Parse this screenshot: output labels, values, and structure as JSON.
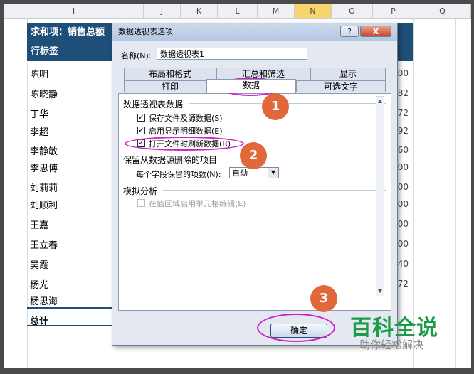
{
  "spreadsheet": {
    "columns": [
      "I",
      "J",
      "K",
      "L",
      "M",
      "N",
      "O",
      "P",
      "Q"
    ],
    "selected_column": "N",
    "pivot_header": "求和项：销售总额",
    "row_label_header": "行标签",
    "rows": [
      {
        "name": "陈明",
        "value": "600"
      },
      {
        "name": "陈晓静",
        "value": "82"
      },
      {
        "name": "丁华",
        "value": "72"
      },
      {
        "name": "李超",
        "value": "592"
      },
      {
        "name": "李静敏",
        "value": "960"
      },
      {
        "name": "李思博",
        "value": "800"
      },
      {
        "name": "刘莉莉",
        "value": "600"
      },
      {
        "name": "刘顺利",
        "value": "000"
      },
      {
        "name": "王嘉",
        "value": "200"
      },
      {
        "name": "王立春",
        "value": "700"
      },
      {
        "name": "吴霞",
        "value": "840"
      },
      {
        "name": "杨光",
        "value": "872"
      },
      {
        "name": "杨思海",
        "value": ""
      }
    ],
    "total_label": "总计"
  },
  "dialog": {
    "title": "数据透视表选项",
    "help_label": "?",
    "close_label": "X",
    "name_label": "名称(N):",
    "name_value": "数据透视表1",
    "tabs_row1": [
      "布局和格式",
      "汇总和筛选",
      "显示"
    ],
    "tabs_row2": [
      "打印",
      "数据",
      "可选文字"
    ],
    "active_tab": "数据",
    "section_data": "数据透视表数据",
    "cb_save_source": "保存文件及源数据(S)",
    "cb_enable_detail": "启用显示明细数据(E)",
    "cb_refresh_open": "打开文件时刷新数据(R)",
    "section_retain": "保留从数据源删除的项目",
    "retain_label": "每个字段保留的项数(N):",
    "retain_value": "自动",
    "section_whatif": "模拟分析",
    "cb_whatif": "在值区域启用单元格编辑(E)",
    "ok_label": "确定"
  },
  "checkbox_states": {
    "save_source": true,
    "enable_detail": true,
    "refresh_open": true,
    "whatif": false
  },
  "badges": [
    "1",
    "2",
    "3"
  ],
  "watermark": {
    "line1": "百科全说",
    "line2": "助你轻松解决"
  },
  "colors": {
    "pivot_header": "#1f4e79",
    "highlight_ellipse": "#d020c8",
    "badge": "#e0683b",
    "watermark": "#1d9c48"
  }
}
